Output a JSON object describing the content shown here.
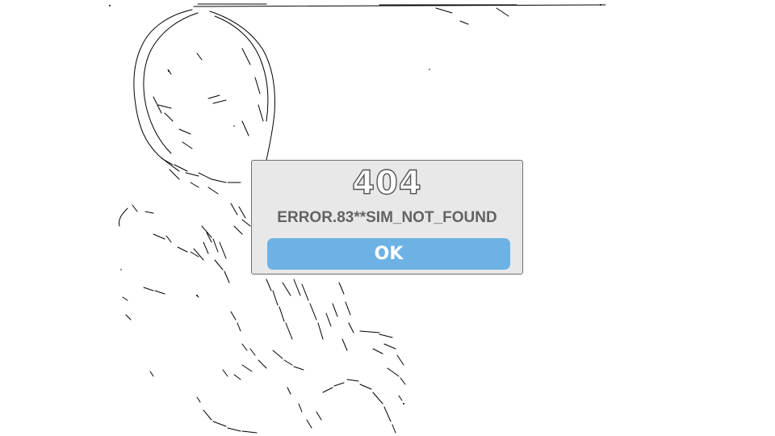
{
  "dialog": {
    "code": "404",
    "message": "ERROR.83**SIM_NOT_FOUND",
    "ok_label": "OK"
  },
  "colors": {
    "background": "#ffffff",
    "dialog_bg": "#e8e8e8",
    "button_bg": "#6cb2e5",
    "message_text": "#636363",
    "sketch_line": "#000000"
  }
}
